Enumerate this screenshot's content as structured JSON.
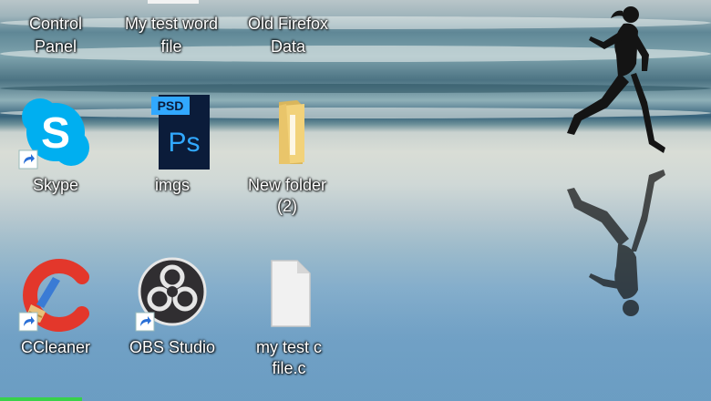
{
  "desktop": {
    "top_row": [
      {
        "label_line1": "Control",
        "label_line2": "Panel"
      },
      {
        "label_line1": "My test word",
        "label_line2": "file"
      },
      {
        "label_line1": "Old Firefox",
        "label_line2": "Data"
      }
    ],
    "icons": [
      {
        "label": "Skype",
        "icon": "skype-icon",
        "shortcut": true
      },
      {
        "label": "imgs",
        "icon": "photoshop-psd-icon",
        "badge": "PSD",
        "glyph": "Ps"
      },
      {
        "label": "New folder (2)",
        "icon": "folder-icon"
      },
      {
        "label": "CCleaner",
        "icon": "ccleaner-icon",
        "shortcut": true
      },
      {
        "label": "OBS Studio",
        "icon": "obs-icon",
        "shortcut": true
      },
      {
        "label": "my test c file.c",
        "icon": "blank-file-icon"
      }
    ]
  },
  "colors": {
    "skype_blue": "#00aff0",
    "psd_dark": "#0b1c3a",
    "psd_blue": "#31a8ff",
    "folder_yellow": "#f2d27a",
    "ccleaner_red": "#e3372b",
    "obs_dark": "#302e31",
    "taskbar_accent": "#38d14a"
  }
}
